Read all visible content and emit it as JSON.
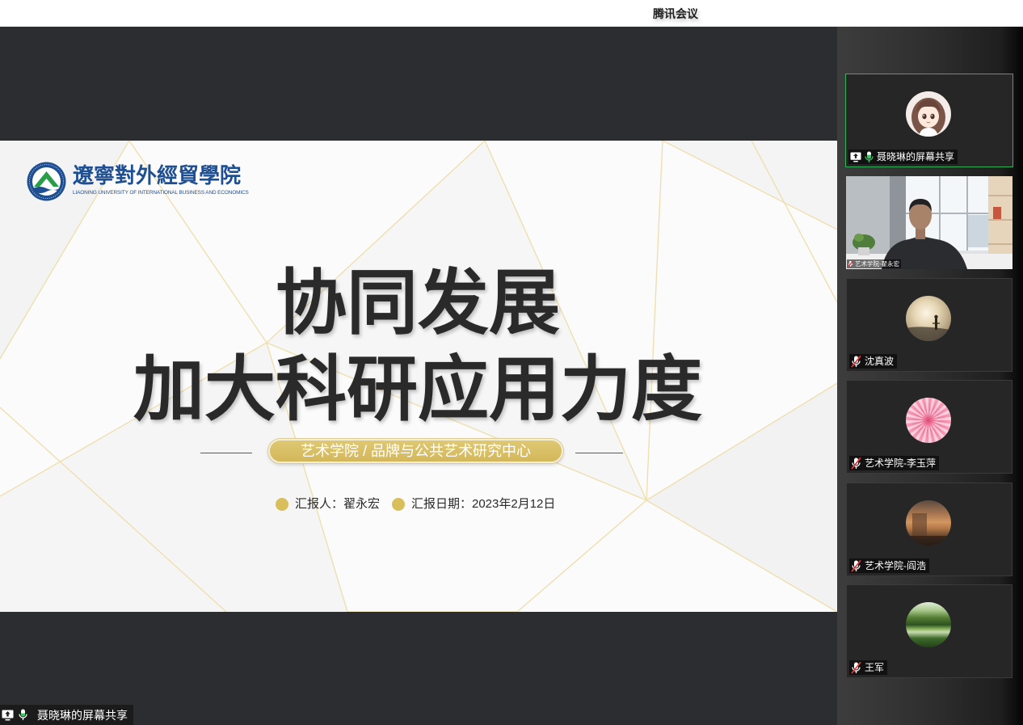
{
  "window": {
    "title": "腾讯会议"
  },
  "slide": {
    "logo": {
      "emblem_icon": "university-emblem-icon",
      "name_cn": "遼寧對外經貿學院",
      "name_en": "LIAONING UNIVERSITY OF INTERNATIONAL BUSINESS AND ECONOMICS"
    },
    "title_line1": "协同发展",
    "title_line2": "加大科研应用力度",
    "department": "艺术学院 / 品牌与公共艺术研究中心",
    "reporter": "汇报人：翟永宏",
    "report_date": "汇报日期：2023年2月12日"
  },
  "screen_share_label": {
    "text": "聂晓琳的屏幕共享",
    "icons": [
      "screen-share-icon",
      "mic-icon"
    ]
  },
  "participants": [
    {
      "name": "聂晓琳的屏幕共享",
      "icons": [
        "screen-share-icon",
        "mic-icon"
      ],
      "active_speaker": true
    },
    {
      "name": "艺术学院-翟永宏",
      "icons": [
        "mic-muted-icon"
      ],
      "video_on": true
    },
    {
      "name": "沈真波",
      "icons": [
        "mic-muted-icon"
      ]
    },
    {
      "name": "艺术学院-李玉萍",
      "icons": [
        "mic-muted-icon"
      ]
    },
    {
      "name": "艺术学院-阎浩",
      "icons": [
        "mic-muted-icon"
      ]
    },
    {
      "name": "王军",
      "icons": [
        "mic-muted-icon"
      ]
    }
  ],
  "colors": {
    "stage_background": "#2c2d30",
    "active_speaker_border": "#2fb35a",
    "slide_gold": "#d6bd66",
    "slide_title": "#2a2a2a",
    "logo_blue": "#1e4f93",
    "mic_active": "#2fcf5a",
    "mic_muted_slash": "#e5383b"
  }
}
